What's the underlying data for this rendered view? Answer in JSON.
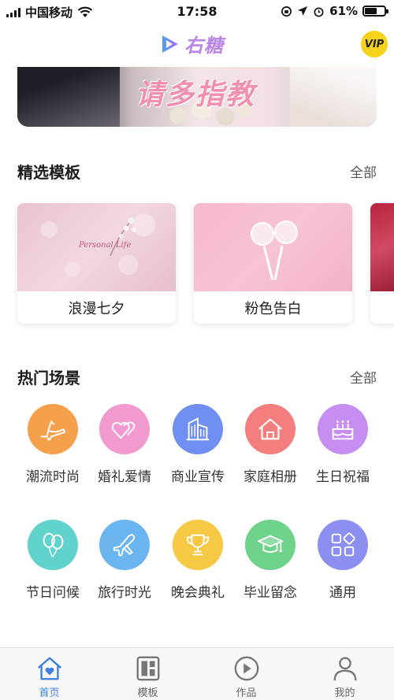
{
  "status_bar": {
    "carrier": "中国移动",
    "time": "17:58",
    "battery": "61%",
    "battery_level": 0.61
  },
  "header": {
    "logo_text": "右糖",
    "vip_label": "VIP"
  },
  "banner": {
    "text": "请多指教"
  },
  "featured_templates": {
    "title": "精选模板",
    "more": "全部",
    "items": [
      {
        "label": "浪漫七夕",
        "thumb_text": "Personal Life"
      },
      {
        "label": "粉色告白"
      }
    ]
  },
  "hot_scenes": {
    "title": "热门场景",
    "more": "全部",
    "items": [
      {
        "label": "潮流时尚",
        "icon": "high-heel-icon",
        "color": "#f5a04a"
      },
      {
        "label": "婚礼爱情",
        "icon": "hearts-icon",
        "color": "#f29ad0"
      },
      {
        "label": "商业宣传",
        "icon": "building-icon",
        "color": "#6f8ff2"
      },
      {
        "label": "家庭相册",
        "icon": "house-icon",
        "color": "#f47d7d"
      },
      {
        "label": "生日祝福",
        "icon": "cake-icon",
        "color": "#c58ef0"
      },
      {
        "label": "节日问候",
        "icon": "balloon-icon",
        "color": "#5fd3cc"
      },
      {
        "label": "旅行时光",
        "icon": "airplane-icon",
        "color": "#6bb6f0"
      },
      {
        "label": "晚会典礼",
        "icon": "trophy-icon",
        "color": "#f7c843"
      },
      {
        "label": "毕业留念",
        "icon": "graduation-cap-icon",
        "color": "#6ed28a"
      },
      {
        "label": "通用",
        "icon": "grid-icon",
        "color": "#8c8ff0"
      }
    ]
  },
  "tab_bar": {
    "tabs": [
      {
        "label": "首页",
        "icon": "home-icon",
        "active": true
      },
      {
        "label": "模板",
        "icon": "template-icon",
        "active": false
      },
      {
        "label": "作品",
        "icon": "play-icon",
        "active": false
      },
      {
        "label": "我的",
        "icon": "user-icon",
        "active": false
      }
    ]
  }
}
